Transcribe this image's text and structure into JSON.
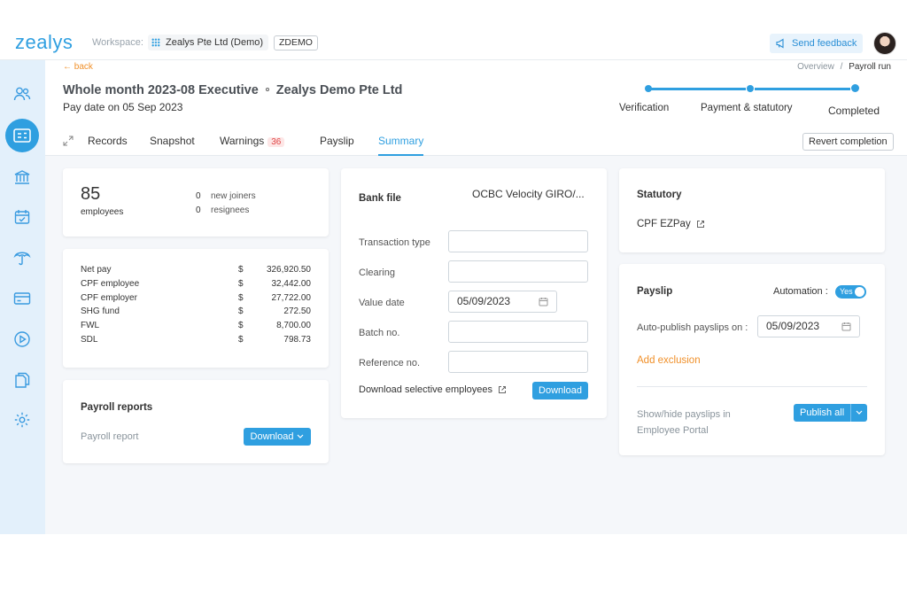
{
  "app": {
    "logo": "zealys"
  },
  "workspace": {
    "label": "Workspace:",
    "name": "Zealys Pte Ltd (Demo)",
    "code": "ZDEMO"
  },
  "header_actions": {
    "feedback": "Send feedback"
  },
  "nav": {
    "back": "back",
    "breadcrumb": [
      "Overview",
      "/",
      "Payroll run"
    ]
  },
  "run": {
    "title": "Whole month 2023-08 Executive",
    "company": "Zealys Demo Pte Ltd",
    "pay_date": "Pay date on 05 Sep 2023"
  },
  "steps": [
    "Verification",
    "Payment & statutory",
    "Completed"
  ],
  "tabs": [
    {
      "label": "Records"
    },
    {
      "label": "Snapshot"
    },
    {
      "label": "Warnings",
      "badge": "36"
    },
    {
      "label": "Payslip"
    },
    {
      "label": "Summary"
    }
  ],
  "revert_label": "Revert completion",
  "employees": {
    "count": "85",
    "count_label": "employees",
    "new_joiners_count": "0",
    "new_joiners_label": "new joiners",
    "resignees_count": "0",
    "resignees_label": "resignees"
  },
  "totals": [
    {
      "label": "Net pay",
      "currency": "$",
      "value": "326,920.50"
    },
    {
      "label": "CPF employee",
      "currency": "$",
      "value": "32,442.00"
    },
    {
      "label": "CPF employer",
      "currency": "$",
      "value": "27,722.00"
    },
    {
      "label": "SHG fund",
      "currency": "$",
      "value": "272.50"
    },
    {
      "label": "FWL",
      "currency": "$",
      "value": "8,700.00"
    },
    {
      "label": "SDL",
      "currency": "$",
      "value": "798.73"
    }
  ],
  "reports": {
    "title": "Payroll reports",
    "item": "Payroll report",
    "download": "Download"
  },
  "bank": {
    "title": "Bank file",
    "bank_select": "OCBC Velocity GIRO/...",
    "fields": [
      {
        "label": "Transaction type",
        "value": ""
      },
      {
        "label": "Clearing",
        "value": ""
      },
      {
        "label": "Value date",
        "value": "05/09/2023"
      },
      {
        "label": "Batch no.",
        "value": ""
      },
      {
        "label": "Reference no.",
        "value": ""
      }
    ],
    "selective_label": "Download selective employees",
    "download": "Download"
  },
  "statutory": {
    "title": "Statutory",
    "link": "CPF EZPay"
  },
  "payslip": {
    "title": "Payslip",
    "automation_label": "Automation :",
    "automation_value": "Yes",
    "auto_publish_label": "Auto-publish payslips on :",
    "auto_publish_date": "05/09/2023",
    "add_exclusion": "Add exclusion",
    "showhide_line1": "Show/hide payslips in",
    "showhide_line2": "Employee Portal",
    "publish_all": "Publish all"
  },
  "colors": {
    "primary": "#2f9fe0",
    "accent": "#f0902a",
    "sidebar": "#e3f0fb",
    "badge": "#e04848"
  }
}
